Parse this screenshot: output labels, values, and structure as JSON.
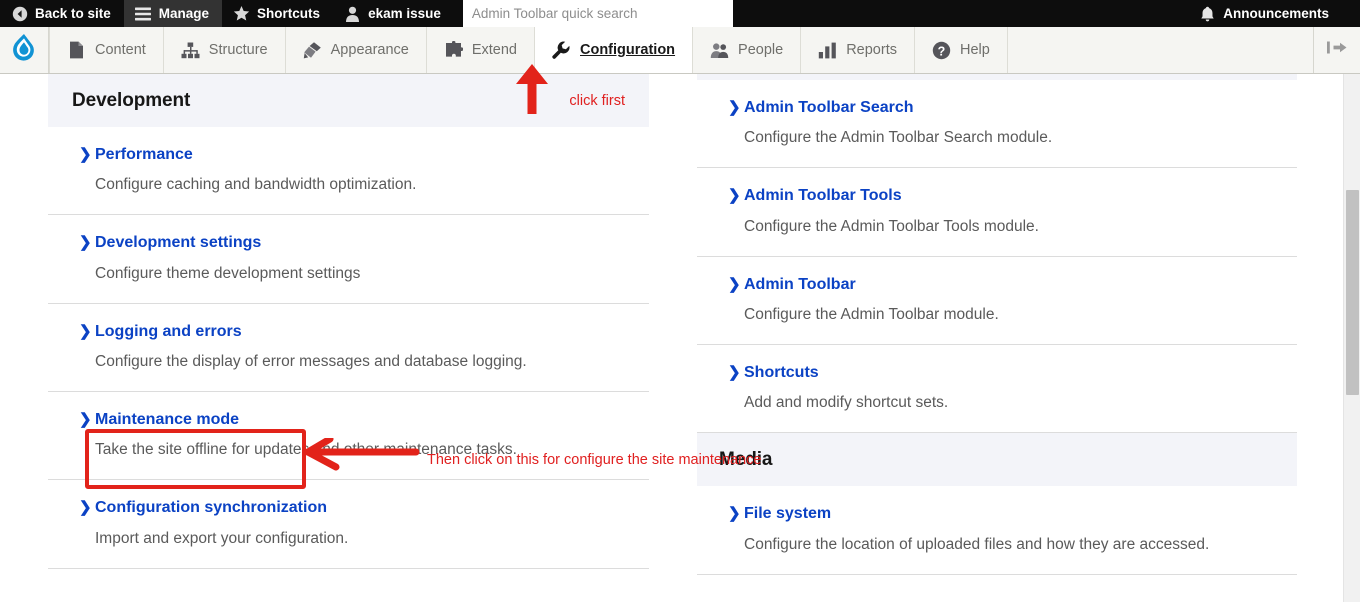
{
  "admin_bar": {
    "items": [
      {
        "label": "Back to site",
        "icon": "back-arrow-circle-icon",
        "active": false
      },
      {
        "label": "Manage",
        "icon": "hamburger-menu-icon",
        "active": true
      },
      {
        "label": "Shortcuts",
        "icon": "star-icon",
        "active": false
      },
      {
        "label": "ekam issue",
        "icon": "user-account-icon",
        "active": false
      }
    ],
    "search": {
      "placeholder": "Admin Toolbar quick search",
      "value": ""
    },
    "announcements": {
      "label": "Announcements",
      "icon": "bell-icon"
    }
  },
  "manage_bar": {
    "logo": "drupal-droplet-logo",
    "logo_color": "#1193d4",
    "tabs": [
      {
        "label": "Content",
        "icon": "document-icon",
        "active": false
      },
      {
        "label": "Structure",
        "icon": "sitemap-icon",
        "active": false
      },
      {
        "label": "Appearance",
        "icon": "paintbrush-icon",
        "active": false
      },
      {
        "label": "Extend",
        "icon": "puzzle-piece-icon",
        "active": false
      },
      {
        "label": "Configuration",
        "icon": "wrench-icon",
        "active": true
      },
      {
        "label": "People",
        "icon": "people-icon",
        "active": false
      },
      {
        "label": "Reports",
        "icon": "bar-chart-icon",
        "active": false
      },
      {
        "label": "Help",
        "icon": "question-circle-icon",
        "active": false
      }
    ],
    "orientation_toggle": "collapse-sidebar-icon"
  },
  "left_column": {
    "sections": [
      {
        "title": "Development",
        "note": "click first",
        "items": [
          {
            "name": "Performance",
            "desc": "Configure caching and bandwidth optimization."
          },
          {
            "name": "Development settings",
            "desc": "Configure theme development settings"
          },
          {
            "name": "Logging and errors",
            "desc": "Configure the display of error messages and database logging."
          },
          {
            "name": "Maintenance mode",
            "desc": "Take the site offline for updates and other maintenance tasks."
          },
          {
            "name": "Configuration synchronization",
            "desc": "Import and export your configuration."
          }
        ]
      }
    ]
  },
  "right_column": {
    "sections": [
      {
        "title": "",
        "items": [
          {
            "name": "Admin Toolbar Search",
            "desc": "Configure the Admin Toolbar Search module."
          },
          {
            "name": "Admin Toolbar Tools",
            "desc": "Configure the Admin Toolbar Tools module."
          },
          {
            "name": "Admin Toolbar",
            "desc": "Configure the Admin Toolbar module."
          },
          {
            "name": "Shortcuts",
            "desc": "Add and modify shortcut sets."
          }
        ]
      },
      {
        "title": "Media",
        "items": [
          {
            "name": "File system",
            "desc": "Configure the location of uploaded files and how they are accessed."
          }
        ]
      }
    ]
  },
  "annotations": {
    "color": "#e02020",
    "highlight_color": "#e2231a",
    "arrow_up_target": "Configuration",
    "note_maintenance": "Then click on this for configure the site maintenance",
    "note_first": "click first"
  }
}
